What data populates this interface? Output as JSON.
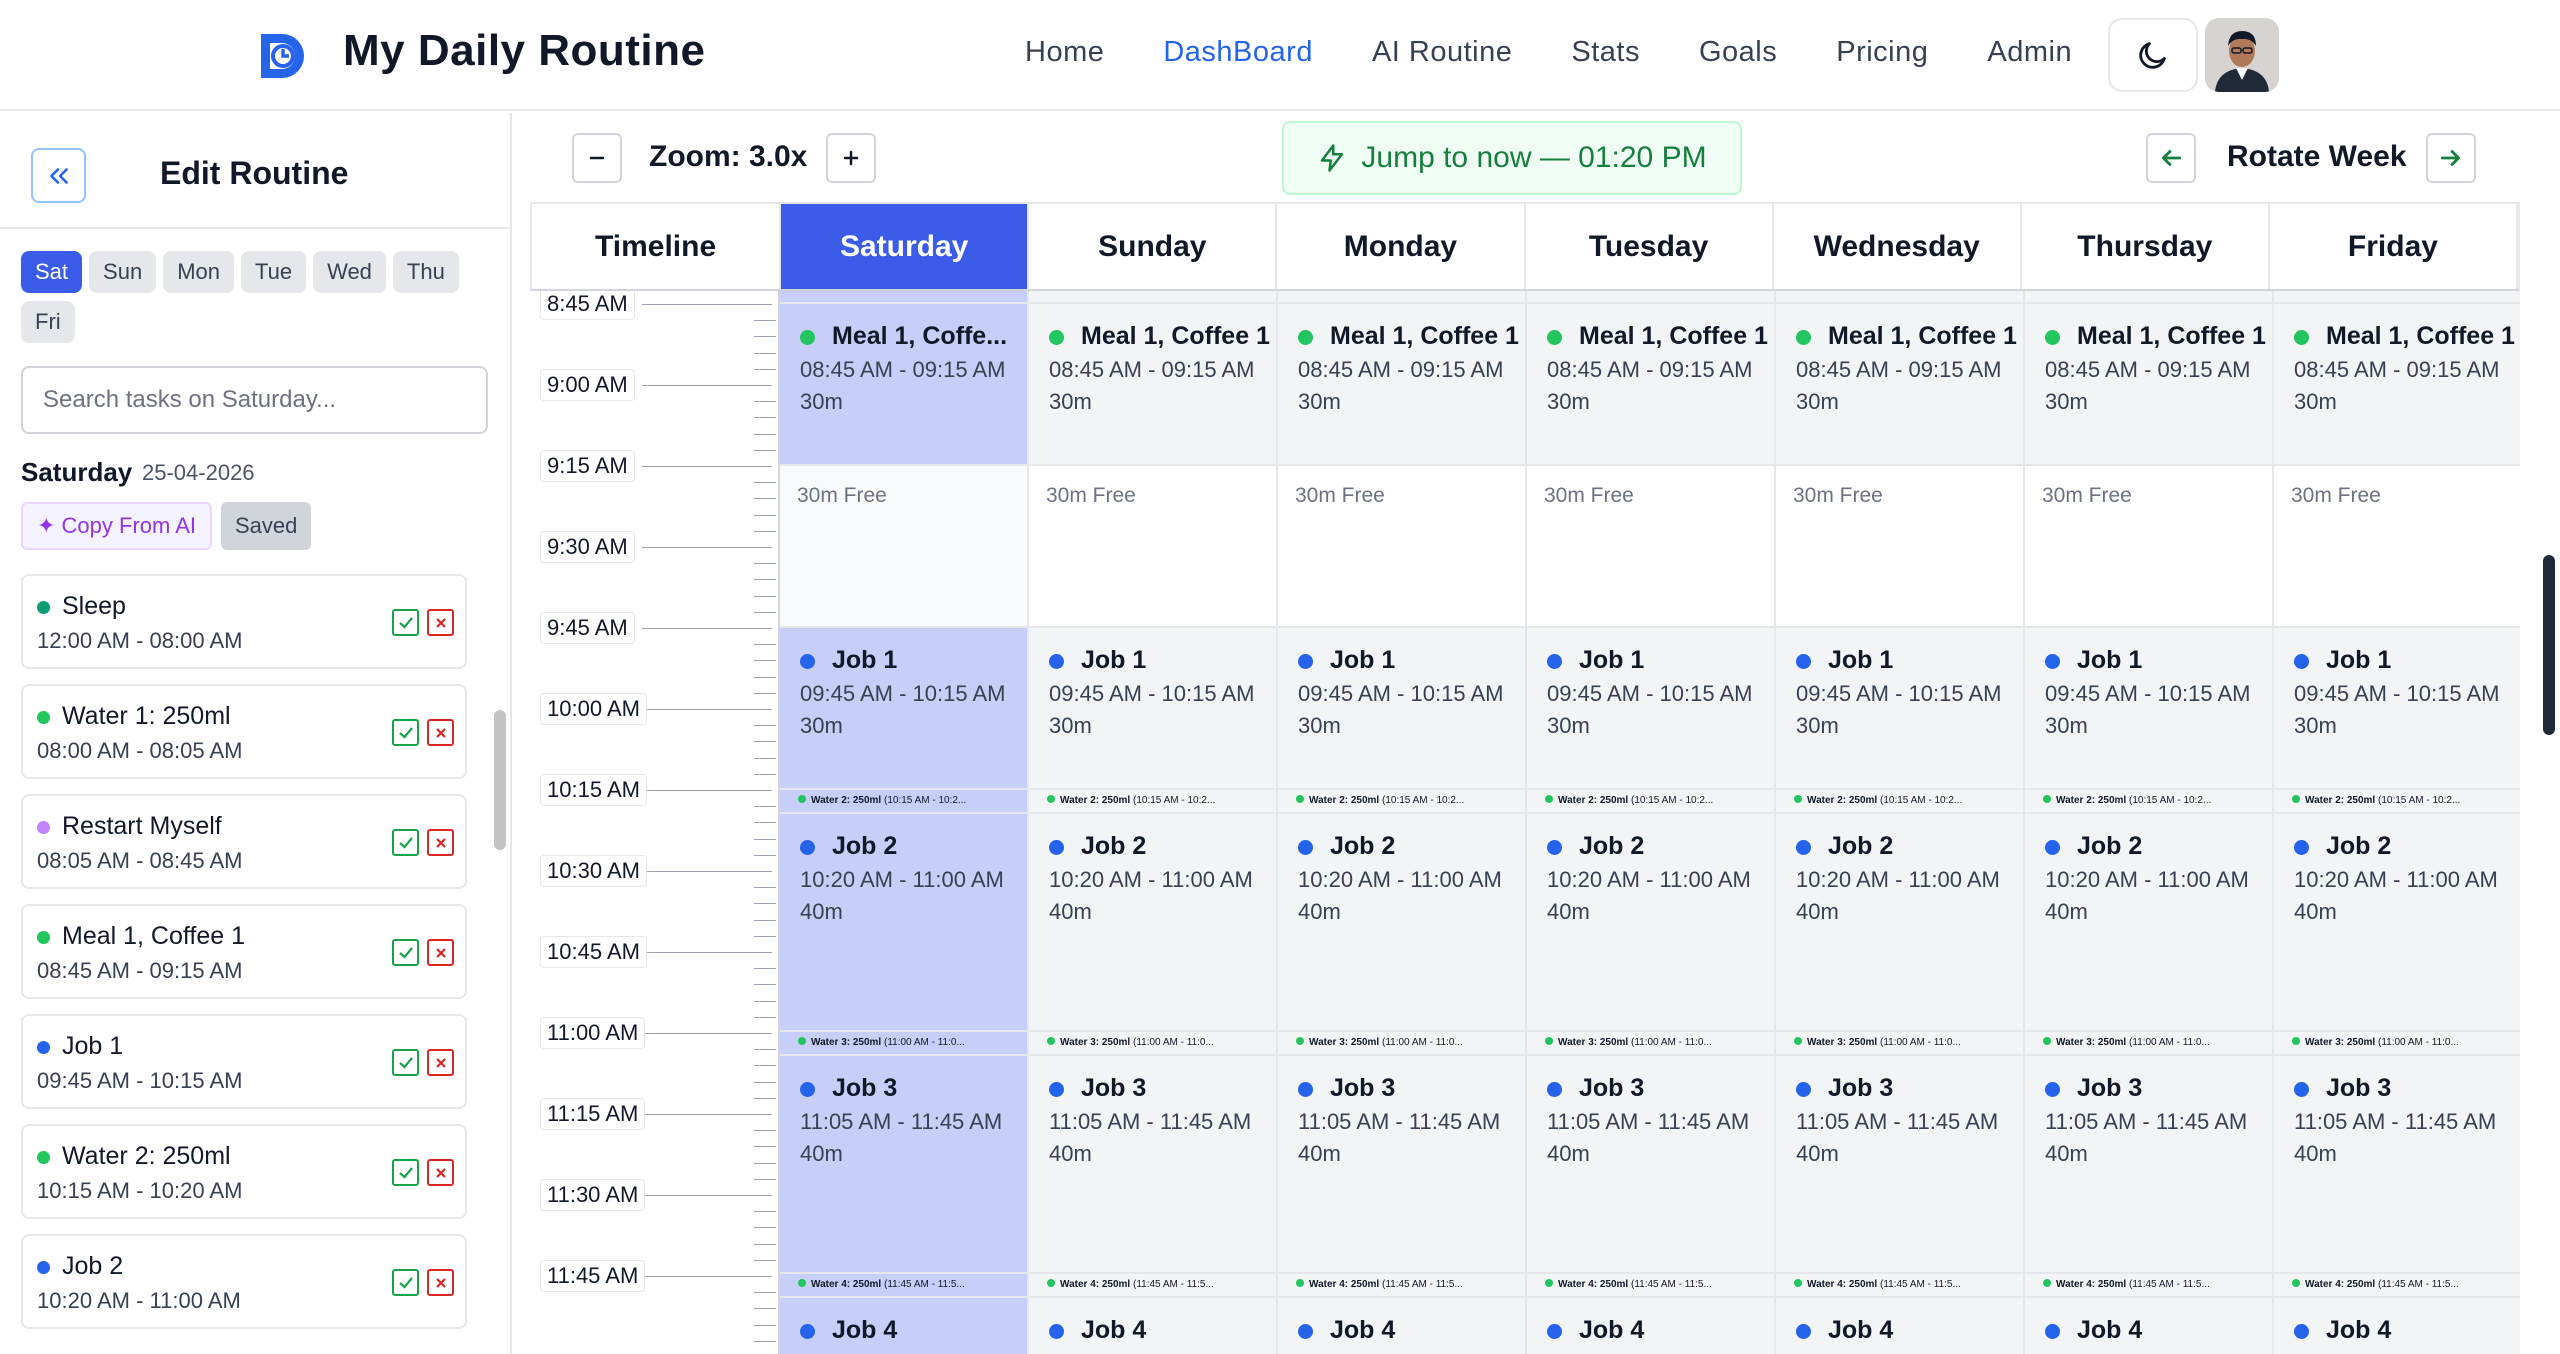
{
  "app": {
    "title": "My Daily Routine"
  },
  "nav": {
    "items": [
      "Home",
      "DashBoard",
      "AI Routine",
      "Stats",
      "Goals",
      "Pricing",
      "Admin"
    ],
    "active": "DashBoard"
  },
  "sidebar": {
    "title": "Edit Routine",
    "days": [
      "Sat",
      "Sun",
      "Mon",
      "Tue",
      "Wed",
      "Thu",
      "Fri"
    ],
    "active_day": "Sat",
    "search_placeholder": "Search tasks on Saturday...",
    "day_name": "Saturday",
    "date": "25-04-2026",
    "copy_ai_label": "✦ Copy From AI",
    "saved_label": "Saved",
    "tasks": [
      {
        "name": "Sleep",
        "time": "12:00 AM - 08:00 AM",
        "color": "#0f9d76"
      },
      {
        "name": "Water 1: 250ml",
        "time": "08:00 AM - 08:05 AM",
        "color": "#22c55e"
      },
      {
        "name": "Restart Myself",
        "time": "08:05 AM - 08:45 AM",
        "color": "#c084fc"
      },
      {
        "name": "Meal 1, Coffee 1",
        "time": "08:45 AM - 09:15 AM",
        "color": "#22c55e"
      },
      {
        "name": "Job 1",
        "time": "09:45 AM - 10:15 AM",
        "color": "#2563eb"
      },
      {
        "name": "Water 2: 250ml",
        "time": "10:15 AM - 10:20 AM",
        "color": "#22c55e"
      },
      {
        "name": "Job 2",
        "time": "10:20 AM - 11:00 AM",
        "color": "#2563eb"
      }
    ]
  },
  "toolbar": {
    "zoom_label": "Zoom: 3.0x",
    "jump_label": "Jump to now — 01:20 PM",
    "rotate_label": "Rotate Week"
  },
  "calendar": {
    "timeline_header": "Timeline",
    "days": [
      "Saturday",
      "Sunday",
      "Monday",
      "Tuesday",
      "Wednesday",
      "Thursday",
      "Friday"
    ],
    "today": "Saturday",
    "times": [
      "8:45 AM",
      "9:00 AM",
      "9:15 AM",
      "9:30 AM",
      "9:45 AM",
      "10:00 AM",
      "10:15 AM",
      "10:30 AM",
      "10:45 AM",
      "11:00 AM",
      "11:15 AM",
      "11:30 AM",
      "11:45 AM"
    ],
    "blocks": [
      {
        "kind": "task",
        "name": "Meal 1, Coffee 1",
        "short_name": "Meal 1, Coffe...",
        "time": "08:45 AM - 09:15 AM",
        "dur": "30m",
        "color": "#22c55e"
      },
      {
        "kind": "free",
        "label": "30m Free"
      },
      {
        "kind": "task",
        "name": "Job 1",
        "time": "09:45 AM - 10:15 AM",
        "dur": "30m",
        "color": "#2563eb"
      },
      {
        "kind": "mini",
        "label": "Water 2: 250ml",
        "time": "(10:15 AM - 10:2..."
      },
      {
        "kind": "task",
        "name": "Job 2",
        "time": "10:20 AM - 11:00 AM",
        "dur": "40m",
        "color": "#2563eb"
      },
      {
        "kind": "mini",
        "label": "Water 3: 250ml",
        "time": "(11:00 AM - 11:0..."
      },
      {
        "kind": "task",
        "name": "Job 3",
        "time": "11:05 AM - 11:45 AM",
        "dur": "40m",
        "color": "#2563eb"
      },
      {
        "kind": "mini",
        "label": "Water 4: 250ml",
        "time": "(11:45 AM - 11:5..."
      },
      {
        "kind": "task",
        "name": "Job 4",
        "time": "",
        "dur": "",
        "color": "#2563eb"
      }
    ]
  }
}
